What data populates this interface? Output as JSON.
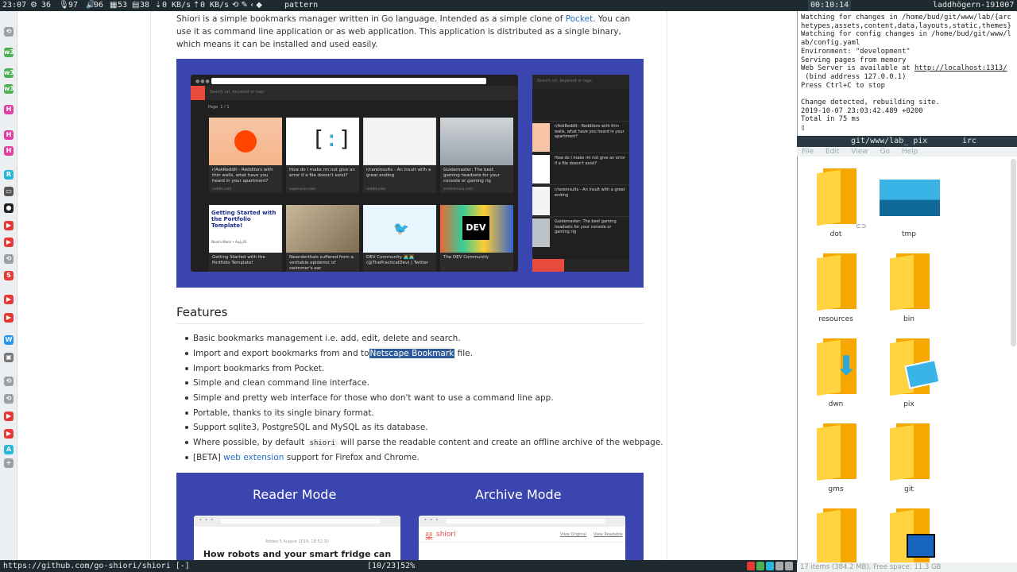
{
  "topbar": {
    "time": "23:07",
    "ws": "36",
    "mic": "97",
    "vol": "96",
    "a": "53",
    "b": "38",
    "net_down": "0 KB/s",
    "net_up": "0 KB/s",
    "search": "pattern",
    "clock": "00:10:14",
    "host": "laddhögern-191007"
  },
  "bottombar": {
    "url": "https://github.com/go-shiori/shiori [-]",
    "position": "[10/23]52%"
  },
  "article": {
    "intro_1": "Shiori is a simple bookmarks manager written in Go language. Intended as a simple clone of ",
    "intro_link": "Pocket",
    "intro_2": ". You can use it as command line application or as web application. This application is distributed as a single binary, which means it can be installed and used easily.",
    "features_heading": "Features",
    "features": [
      "Basic bookmarks management i.e. add, edit, delete and search.",
      "Import bookmarks from Pocket.",
      "Simple and clean command line interface.",
      "Simple and pretty web interface for those who don't want to use a command line app.",
      "Portable, thanks to its single binary format.",
      "Support sqlite3, PostgreSQL and MySQL as its database."
    ],
    "feature_import_pre": "Import and export bookmarks from and to",
    "feature_import_link": "Netscape Bookmark",
    "feature_import_post": " file.",
    "feature_parse_pre": "Where possible, by default ",
    "feature_parse_code": "shiori",
    "feature_parse_post": " will parse the readable content and create an offline archive of the webpage.",
    "feature_beta_pre": "[BETA] ",
    "feature_beta_link": "web extension",
    "feature_beta_post": " support for Firefox and Chrome.",
    "reader_mode": "Reader Mode",
    "archive_mode": "Archive Mode",
    "reader_date": "Added 5 August 2019, 18:52:30",
    "reader_title": "How robots and your smart fridge can",
    "archive_brand": "shiori",
    "archive_link1": "View Original",
    "archive_link2": "View Readable"
  },
  "shot": {
    "search_placeholder": "Search url, keyword or tags",
    "page_label": "Page",
    "page_num": "1",
    "page_total": "/ 1",
    "cards": [
      {
        "title": "r/AskReddit - Redditors with thin walls, what have you heard in your apartment?",
        "host": "reddit.com"
      },
      {
        "title": "How do I make rm not give an error if a file doesn't exist?",
        "host": "superuser.com"
      },
      {
        "title": "r/rareinsults - An insult with a great ending",
        "host": "reddit.com"
      },
      {
        "title": "Guidemaster: The best gaming headsets for your console or gaming rig",
        "host": "arstechnica.com"
      },
      {
        "title": "Getting Started with the Portfolio Template!",
        "host": "dev.to"
      },
      {
        "title": "Neanderthals suffered from a veritable epidemic of swimmer's ear",
        "host": "arstechnica.com"
      },
      {
        "title": "DEV Community 👩‍💻👨‍💻 (@ThePracticalDev) | Twitter",
        "host": "twitter.com"
      },
      {
        "title": "The DEV Community",
        "host": "dev.to"
      }
    ],
    "portfolio_banner": "Getting Started with the Portfolio Template!",
    "portfolio_author": "Naomi Mami • Aug 20",
    "dev_logo": "DEV",
    "mobile_search": "Search url, keyword or tags"
  },
  "terminal": {
    "lines": [
      "Watching for changes in /home/bud/git/www/lab/{arc",
      "hetypes,assets,content,data,layouts,static,themes}",
      "Watching for config changes in /home/bud/git/www/l",
      "ab/config.yaml",
      "Environment: \"development\"",
      "Serving pages from memory",
      "Web Server is available at ",
      " (bind address 127.0.0.1)",
      "Press Ctrl+C to stop",
      "",
      "Change detected, rebuilding site.",
      "2019-10-07 23:03:42.489 +0200",
      "Total in 75 ms"
    ],
    "server_url": "http://localhost:1313/"
  },
  "filemanager": {
    "tab1": "git/www/lab_ pix",
    "tab2": "irc",
    "menu": [
      "File",
      "Edit",
      "View",
      "Go",
      "Help"
    ],
    "items": [
      "dot",
      "tmp",
      "resources",
      "bin",
      "dwn",
      "pix",
      "gms",
      "git"
    ],
    "status": "17 items (384.2 MB), Free space: 11.3 GB"
  }
}
